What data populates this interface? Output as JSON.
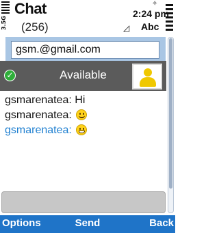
{
  "header": {
    "title": "Chat",
    "count": "(256)",
    "time": "2:24 pm",
    "input_mode": "Abc",
    "network": "3.5G"
  },
  "contact": {
    "email": "gsm.@gmail.com"
  },
  "status": {
    "label": "Available",
    "color": "#2fae3a"
  },
  "messages": [
    {
      "sender": "gsmarenatea:",
      "text": "Hi",
      "emoji": null
    },
    {
      "sender": "gsmarenatea:",
      "text": "",
      "emoji": "smile"
    },
    {
      "sender": "gsmarenatea:",
      "text": "",
      "emoji": "grin"
    }
  ],
  "softkeys": {
    "left": "Options",
    "middle": "Send",
    "right": "Back"
  },
  "colors": {
    "softkey_bar": "#1f74c8",
    "own_message": "#1e7fd0",
    "status_bar": "#5b5b5b"
  }
}
